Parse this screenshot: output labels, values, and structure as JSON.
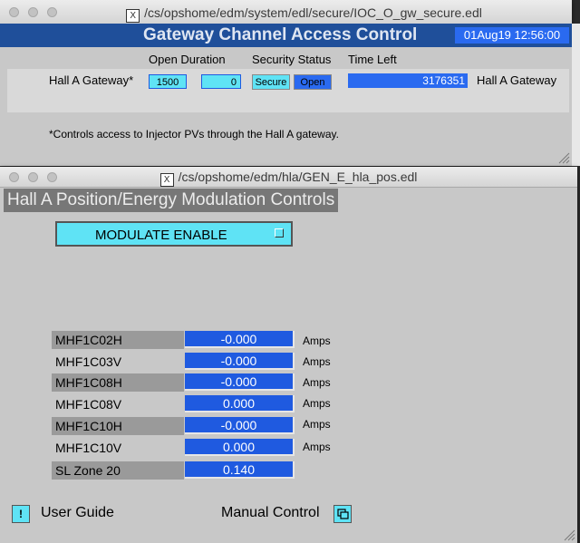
{
  "window1": {
    "title": "/cs/opshome/edm/system/edl/secure/IOC_O_gw_secure.edl",
    "header": "Gateway Channel Access Control",
    "datetime": "01Aug19 12:56:00",
    "col_open_duration": "Open Duration",
    "col_security_status": "Security Status",
    "col_time_left": "Time Left",
    "row_label": "Hall A Gateway*",
    "duration_value": "1500",
    "second_value": "0",
    "secure_button": "Secure",
    "open_button": "Open",
    "time_left_value": "3176351",
    "row_right_label": "Hall A Gateway",
    "footnote": "*Controls access to Injector PVs through the Hall A gateway."
  },
  "window2": {
    "title": "/cs/opshome/edm/hla/GEN_E_hla_pos.edl",
    "header": "Hall A Position/Energy Modulation Controls",
    "modulate_button": "MODULATE ENABLE",
    "rows": [
      {
        "name": "MHF1C02H",
        "value": "-0.000",
        "unit": "Amps"
      },
      {
        "name": "MHF1C03V",
        "value": "-0.000",
        "unit": "Amps"
      },
      {
        "name": "MHF1C08H",
        "value": "-0.000",
        "unit": "Amps"
      },
      {
        "name": "MHF1C08V",
        "value": "0.000",
        "unit": "Amps"
      },
      {
        "name": "MHF1C10H",
        "value": "-0.000",
        "unit": "Amps"
      },
      {
        "name": "MHF1C10V",
        "value": "0.000",
        "unit": "Amps"
      },
      {
        "name": "SL Zone 20",
        "value": "0.140",
        "unit": ""
      }
    ],
    "user_guide": "User Guide",
    "manual_control": "Manual Control"
  },
  "colors": {
    "accent_blue": "#1f5ae0",
    "cyan": "#5fe3f5",
    "header_bg": "#1f4f9a",
    "panel": "#c8c8c8"
  }
}
